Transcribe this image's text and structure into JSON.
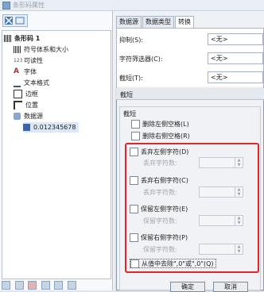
{
  "window": {
    "title": "条形码属性"
  },
  "left_tree": {
    "items": [
      {
        "label": "条形码 1",
        "icon": "barcode-root-icon"
      },
      {
        "label": "符号体系和大小",
        "icon": "symbology-icon"
      },
      {
        "label": "可读性",
        "icon": "readability-icon"
      },
      {
        "label": "字体",
        "icon": "font-icon"
      },
      {
        "label": "文本格式",
        "icon": "text-format-icon"
      },
      {
        "label": "边框",
        "icon": "border-icon"
      },
      {
        "label": "位置",
        "icon": "position-icon"
      },
      {
        "label": "数据源",
        "icon": "datasource-icon"
      },
      {
        "label": "0.012345678",
        "icon": "data-value-icon"
      }
    ]
  },
  "tabs": [
    "数据源",
    "数据类型",
    "转换"
  ],
  "fields": {
    "suppress_label": "抑制(S):",
    "suppress_value": "<无>",
    "char_filter_label": "字符筛选器(C):",
    "char_filter_value": "<无>",
    "truncate_label": "截短(T):",
    "truncate_value": "<无>"
  },
  "dialog": {
    "title": "截短",
    "group_title": "截短",
    "options": {
      "delete_left_space": "删除左侧空格(L)",
      "delete_right_space": "删除右侧空格(R)",
      "discard_left_chars": "丢弃左侧字符(D)",
      "discard_right_chars": "丢弃右侧字符(C)",
      "keep_left_chars": "保留左侧字符(E)",
      "keep_right_chars": "保留右侧字符(P)",
      "remove_zeros": "从值中去除\",0\"或\",0\"(Q)"
    },
    "discard_count_label": "丢弃字符数:",
    "keep_count_label": "保留字符数:",
    "ok": "确定",
    "cancel": "取消"
  },
  "colors": {
    "highlight_box": "#e0252a",
    "tab_border": "#aab6c6"
  }
}
